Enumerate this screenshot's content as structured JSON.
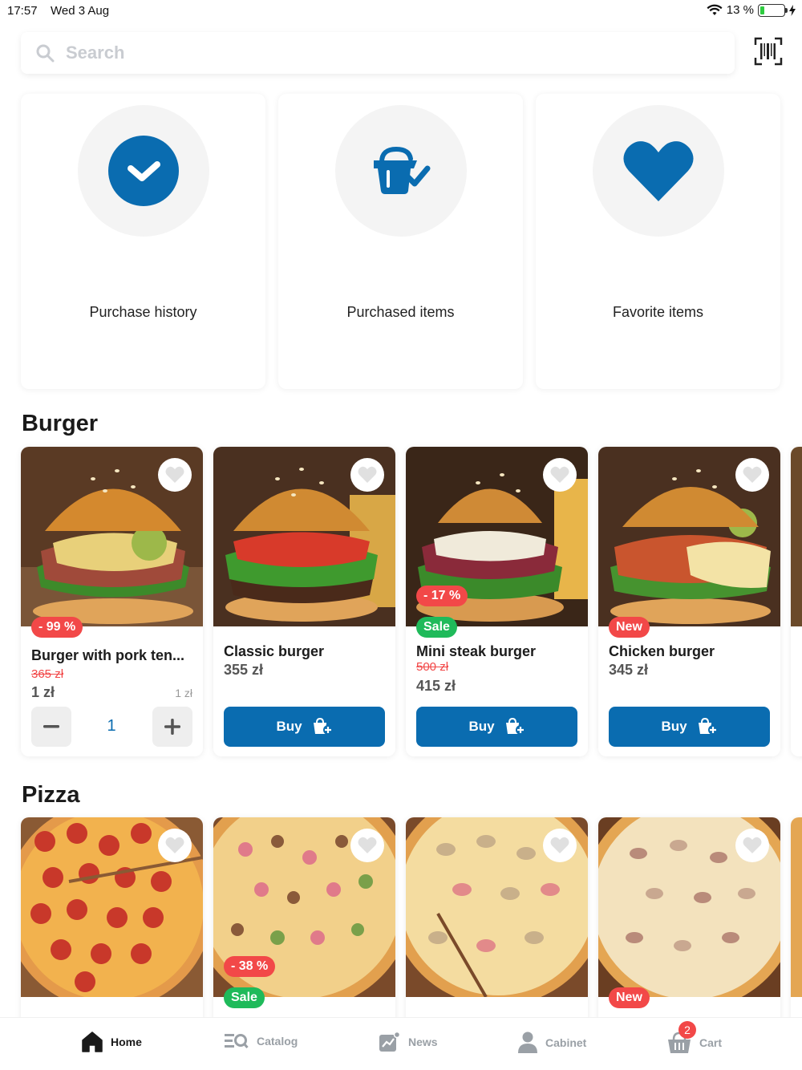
{
  "status_bar": {
    "time": "17:57",
    "date": "Wed 3 Aug",
    "battery": "13 %",
    "battery_level": 0.13
  },
  "search": {
    "placeholder": "Search",
    "value": ""
  },
  "quick_tiles": [
    {
      "label": "Purchase history",
      "icon": "check-circle-icon"
    },
    {
      "label": "Purchased items",
      "icon": "basket-check-icon"
    },
    {
      "label": "Favorite items",
      "icon": "heart-icon"
    }
  ],
  "sections": {
    "burger": {
      "title": "Burger",
      "products": [
        {
          "name": "Burger with pork ten...",
          "old_price": "365 zł",
          "price": "1 zł",
          "unit_price": "1 zł",
          "discount": "- 99 %",
          "quantity": "1"
        },
        {
          "name": "Classic burger",
          "price": "355 zł",
          "buy_label": "Buy"
        },
        {
          "name": "Mini steak burger",
          "old_price": "500 zł",
          "price": "415 zł",
          "discount": "- 17 %",
          "tag": "Sale",
          "buy_label": "Buy"
        },
        {
          "name": "Chicken burger",
          "price": "345 zł",
          "tag": "New",
          "buy_label": "Buy"
        }
      ]
    },
    "pizza": {
      "title": "Pizza",
      "products": [
        {},
        {
          "discount": "- 38 %",
          "tag": "Sale"
        },
        {},
        {
          "tag": "New"
        }
      ]
    }
  },
  "tab_bar": {
    "items": [
      {
        "label": "Home",
        "icon": "home-icon",
        "active": true
      },
      {
        "label": "Catalog",
        "icon": "catalog-search-icon"
      },
      {
        "label": "News",
        "icon": "news-chart-icon"
      },
      {
        "label": "Cabinet",
        "icon": "user-icon"
      },
      {
        "label": "Cart",
        "icon": "basket-icon",
        "badge": "2"
      }
    ]
  },
  "colors": {
    "primary": "#0a6cb0",
    "discount": "#f24848",
    "sale": "#1fba5a"
  }
}
